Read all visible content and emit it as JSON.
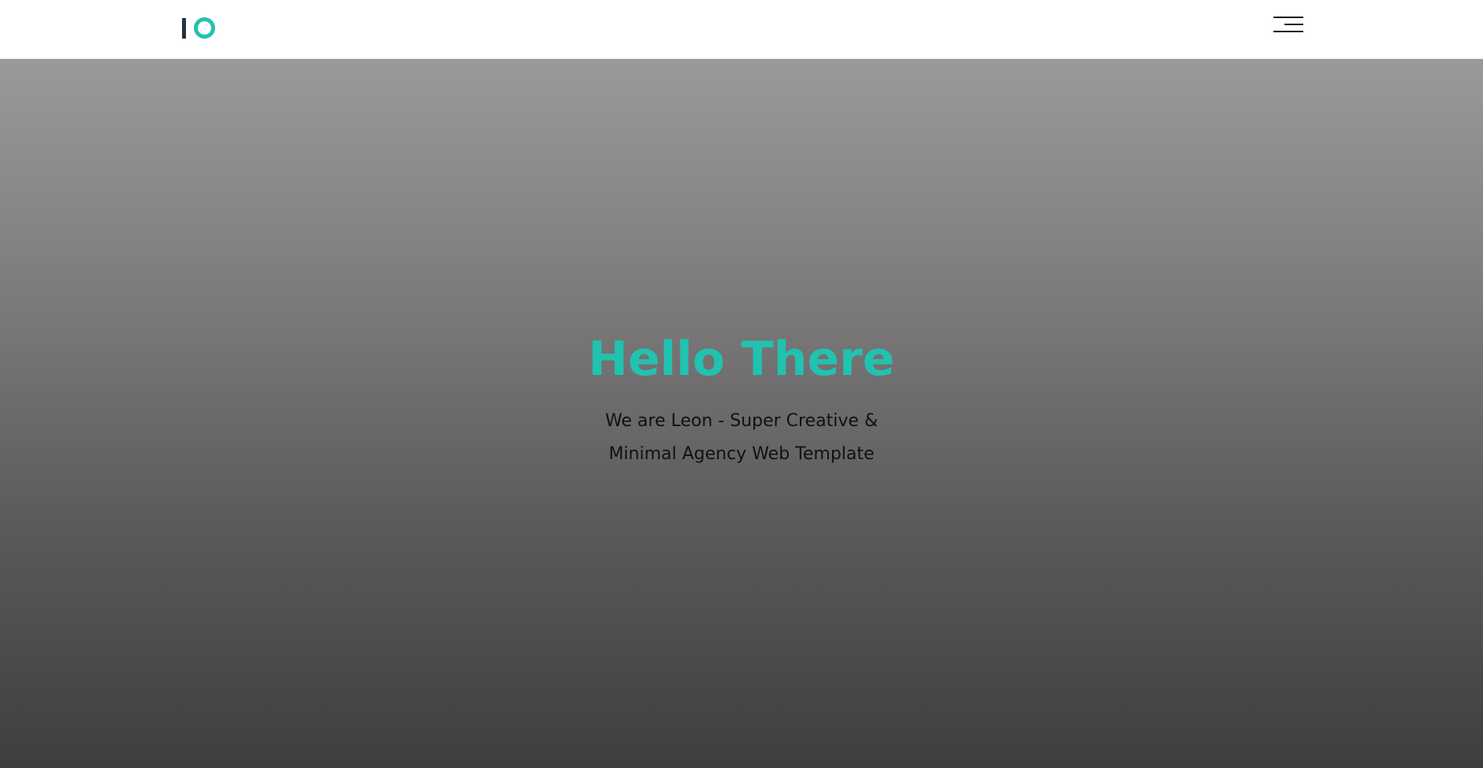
{
  "header": {
    "logo": {
      "letter": "I",
      "ring_color": "#21c2b0",
      "bar_color": "#23353f"
    },
    "menu_icon": "hamburger-menu-icon"
  },
  "hero": {
    "title": "Hello There",
    "subtitle_line1": "We are Leon - Super Creative &",
    "subtitle_line2": "Minimal Agency Web Template",
    "title_color": "#21c2b0"
  }
}
